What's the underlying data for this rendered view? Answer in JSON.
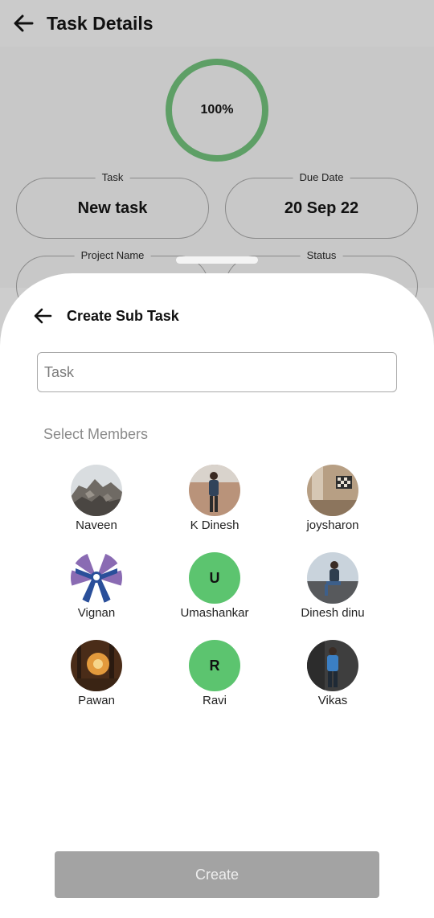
{
  "header": {
    "title": "Task Details"
  },
  "progress": {
    "value_label": "100%",
    "value": 1.0,
    "color": "#5e9f66"
  },
  "fields": {
    "task": {
      "label": "Task",
      "value": "New task"
    },
    "due_date": {
      "label": "Due Date",
      "value": "20 Sep 22"
    },
    "project_name": {
      "label": "Project Name"
    },
    "status": {
      "label": "Status"
    }
  },
  "sheet": {
    "title": "Create Sub Task",
    "task_input": {
      "placeholder": "Task",
      "value": ""
    },
    "select_members_label": "Select Members",
    "members": [
      {
        "name": "Naveen",
        "avatar": "photo-rocks"
      },
      {
        "name": "K Dinesh",
        "avatar": "photo-person-standing"
      },
      {
        "name": "joysharon",
        "avatar": "photo-room"
      },
      {
        "name": "Vignan",
        "avatar": "logo-vignan"
      },
      {
        "name": "Umashankar",
        "avatar": "initial",
        "initial": "U"
      },
      {
        "name": "Dinesh dinu",
        "avatar": "photo-person-sitting"
      },
      {
        "name": "Pawan",
        "avatar": "photo-sunset-forest"
      },
      {
        "name": "Ravi",
        "avatar": "initial",
        "initial": "R"
      },
      {
        "name": "Vikas",
        "avatar": "photo-person-blue-shirt"
      }
    ],
    "create_button": "Create"
  },
  "colors": {
    "initial_avatar_bg": "#5cc46f",
    "create_disabled": "#a3a3a3"
  }
}
